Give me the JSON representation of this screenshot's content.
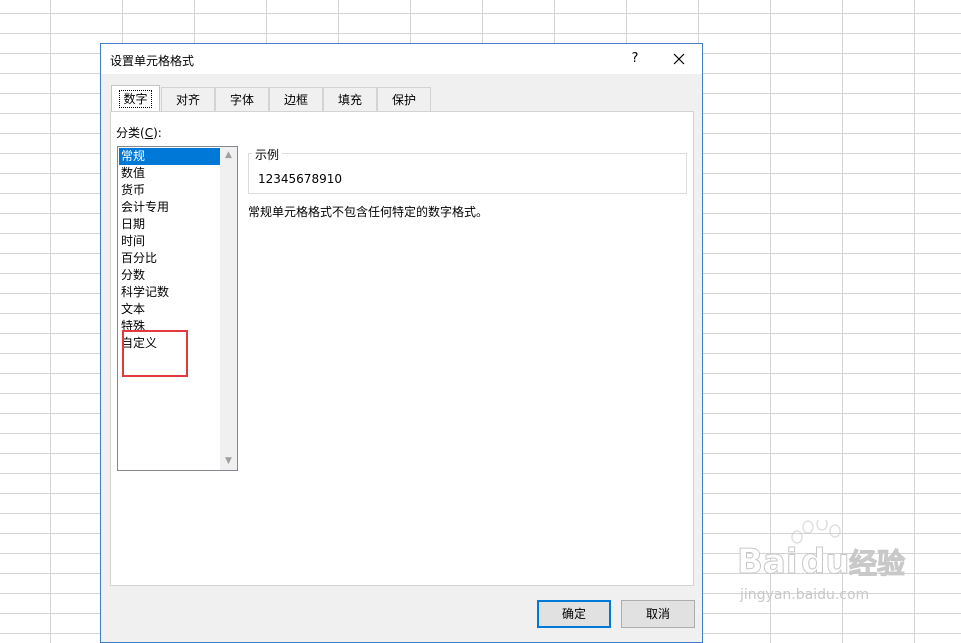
{
  "dialog": {
    "title": "设置单元格格式",
    "help_label": "?",
    "tabs": [
      {
        "label": "数字",
        "active": true
      },
      {
        "label": "对齐"
      },
      {
        "label": "字体"
      },
      {
        "label": "边框"
      },
      {
        "label": "填充"
      },
      {
        "label": "保护"
      }
    ],
    "category": {
      "label_prefix": "分类(",
      "label_key": "C",
      "label_suffix": "):",
      "items": [
        "常规",
        "数值",
        "货币",
        "会计专用",
        "日期",
        "时间",
        "百分比",
        "分数",
        "科学记数",
        "文本",
        "特殊",
        "自定义"
      ],
      "selected_index": 0
    },
    "sample": {
      "legend": "示例",
      "value": "12345678910"
    },
    "description": "常规单元格格式不包含任何特定的数字格式。",
    "buttons": {
      "ok": "确定",
      "cancel": "取消"
    }
  },
  "watermark": {
    "brand_left": "Bai",
    "brand_right": "du",
    "suffix": "经验",
    "url": "jingyan.baidu.com"
  },
  "colors": {
    "selection": "#0078d7",
    "highlight_box": "#e0393e",
    "dialog_border": "#3f7fc7"
  }
}
